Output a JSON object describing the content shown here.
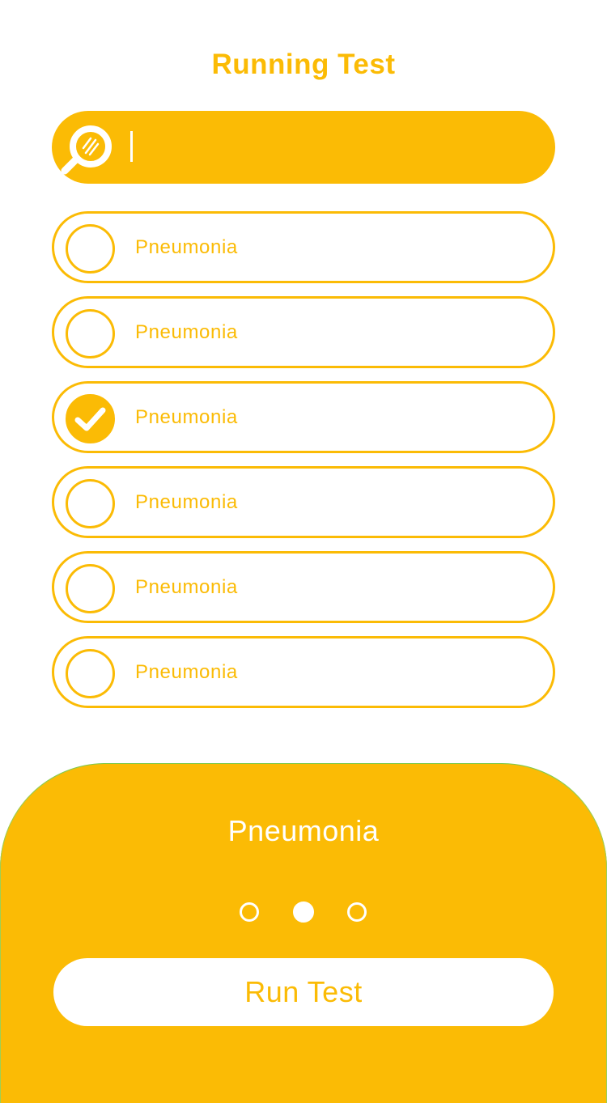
{
  "colors": {
    "accent": "#FBBB05",
    "panel_edge": "#7EC94A",
    "background": "#FFFFFF"
  },
  "header": {
    "title": "Running Test"
  },
  "search": {
    "icon": "search-icon",
    "value": "",
    "placeholder": ""
  },
  "tests": [
    {
      "label": "Pneumonia",
      "checked": false
    },
    {
      "label": "Pneumonia",
      "checked": false
    },
    {
      "label": "Pneumonia",
      "checked": true
    },
    {
      "label": "Pneumonia",
      "checked": false
    },
    {
      "label": "Pneumonia",
      "checked": false
    },
    {
      "label": "Pneumonia",
      "checked": false
    }
  ],
  "panel": {
    "selected_title": "Pneumonia",
    "pager": {
      "count": 3,
      "active_index": 1
    },
    "run_button_label": "Run Test"
  }
}
